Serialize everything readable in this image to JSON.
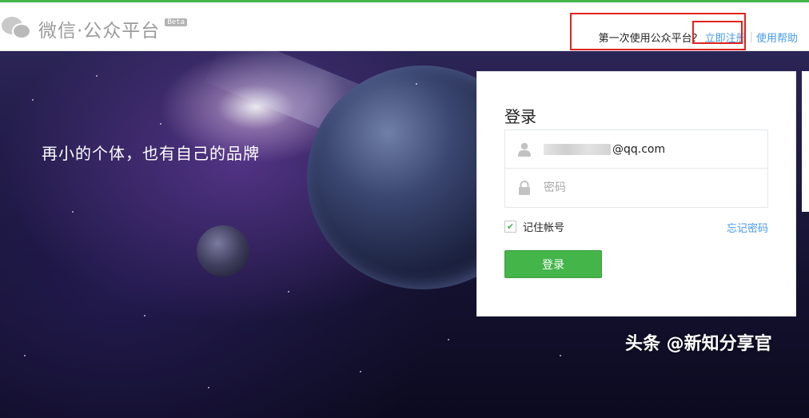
{
  "header": {
    "logo_text": "微信·公众平台",
    "beta_badge": "Beta",
    "first_time_question": "第一次使用公众平台？",
    "register_link": "立即注册",
    "help_link": "使用帮助"
  },
  "hero": {
    "slogan": "再小的个体，也有自己的品牌"
  },
  "login": {
    "title": "登录",
    "username_suffix": "@qq.com",
    "password_placeholder": "密码",
    "remember_label": "记住帐号",
    "remember_checked": true,
    "forgot_link": "忘记密码",
    "submit_label": "登录"
  },
  "watermark": "头条 @新知分享官",
  "icons": {
    "logo": "wechat-logo-icon",
    "user": "user-icon",
    "password": "lock-icon",
    "checkbox": "checkmark-icon"
  },
  "colors": {
    "brand_green": "#44b549",
    "link_blue": "#459ae9",
    "annotation_red": "#e1231f"
  }
}
